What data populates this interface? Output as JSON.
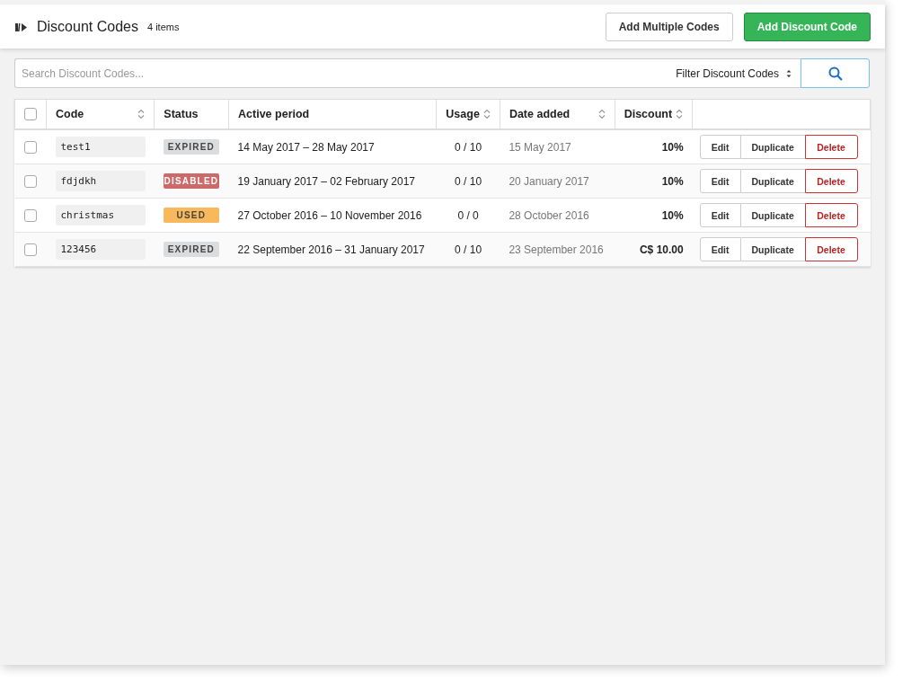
{
  "header": {
    "title": "Discount Codes",
    "count": "4 items",
    "buttons": [
      {
        "label": "Add Multiple Codes",
        "kind": "default"
      },
      {
        "label": "Add Discount Code",
        "kind": "primary"
      }
    ]
  },
  "search": {
    "placeholder": "Search Discount Codes...",
    "filter": "Filter Discount Codes"
  },
  "table": {
    "select_all_checked": false,
    "columns": [
      {
        "label": "Code",
        "sortable": true
      },
      {
        "label": "Status",
        "sortable": false
      },
      {
        "label": "Active period",
        "sortable": false
      },
      {
        "label": "Usage",
        "sortable": true
      },
      {
        "label": "Date added",
        "sortable": true
      },
      {
        "label": "Discount",
        "sortable": true
      }
    ],
    "rows": [
      {
        "checked": false,
        "code": "test1",
        "status": "EXPIRED",
        "kind": "expired",
        "period": "14 May 2017 – 28 May 2017",
        "usage": "0 / 10",
        "date_added": "15 May 2017",
        "discount": "10%",
        "actions": [
          "Edit",
          "Duplicate",
          "Delete"
        ]
      },
      {
        "checked": false,
        "code": "fdjdkh",
        "status": "DISABLED",
        "kind": "disabled",
        "period": "19 January 2017 – 02 February 2017",
        "usage": "0 / 10",
        "date_added": "20 January 2017",
        "discount": "10%",
        "actions": [
          "Edit",
          "Duplicate",
          "Delete"
        ]
      },
      {
        "checked": false,
        "code": "christmas",
        "status": "USED",
        "kind": "used",
        "period": "27 October 2016 – 10 November 2016",
        "usage": "0 / 0",
        "date_added": "28 October 2016",
        "discount": "10%",
        "actions": [
          "Edit",
          "Duplicate",
          "Delete"
        ]
      },
      {
        "checked": false,
        "code": "123456",
        "status": "EXPIRED",
        "kind": "expired",
        "period": "22 September 2016 – 31 January 2017",
        "usage": "0 / 10",
        "date_added": "23 September 2016",
        "discount": "C$ 10.00",
        "actions": [
          "Edit",
          "Duplicate",
          "Delete"
        ]
      }
    ]
  }
}
